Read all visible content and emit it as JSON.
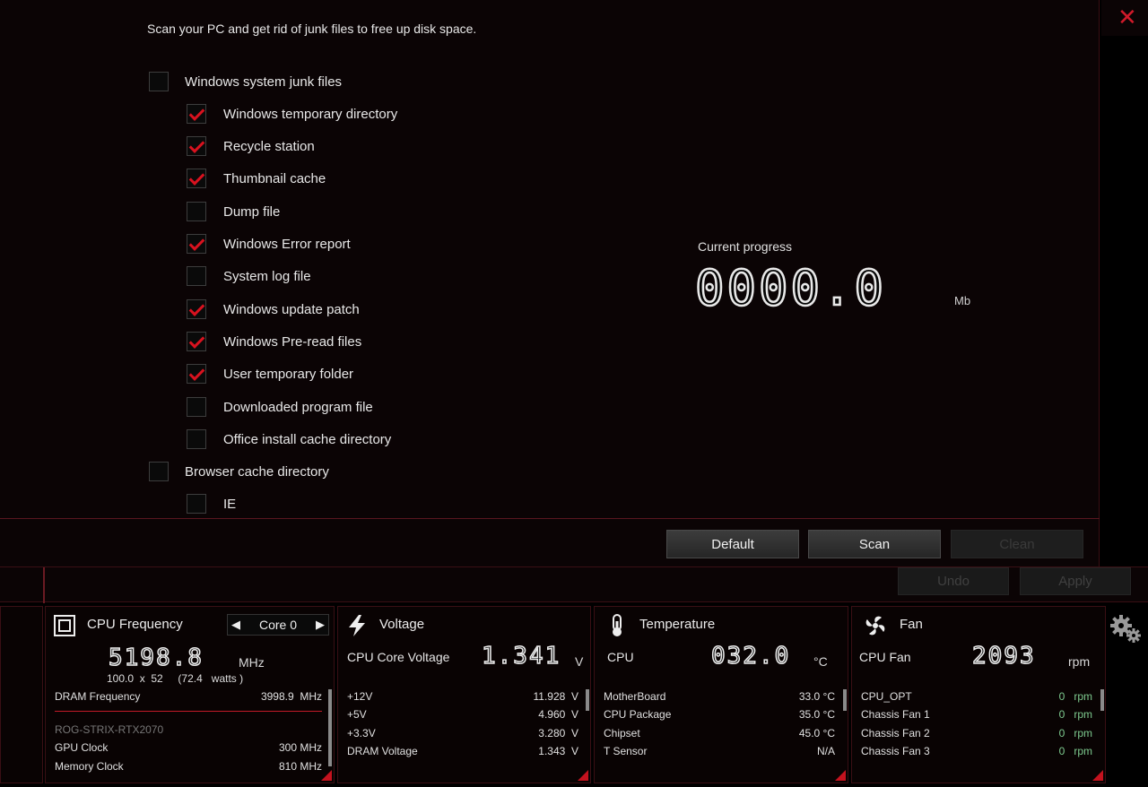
{
  "description": "Scan your PC and get rid of junk files to free up disk space.",
  "checklist": [
    {
      "label": "Windows system junk files",
      "checked": false,
      "level": 0
    },
    {
      "label": "Windows temporary directory",
      "checked": true,
      "level": 1
    },
    {
      "label": "Recycle station",
      "checked": true,
      "level": 1
    },
    {
      "label": "Thumbnail cache",
      "checked": true,
      "level": 1
    },
    {
      "label": "Dump file",
      "checked": false,
      "level": 1
    },
    {
      "label": "Windows Error report",
      "checked": true,
      "level": 1
    },
    {
      "label": "System log file",
      "checked": false,
      "level": 1
    },
    {
      "label": "Windows update patch",
      "checked": true,
      "level": 1
    },
    {
      "label": "Windows Pre-read files",
      "checked": true,
      "level": 1
    },
    {
      "label": "User temporary folder",
      "checked": true,
      "level": 1
    },
    {
      "label": "Downloaded program file",
      "checked": false,
      "level": 1
    },
    {
      "label": "Office install cache directory",
      "checked": false,
      "level": 1
    },
    {
      "label": "Browser cache directory",
      "checked": false,
      "level": 0
    },
    {
      "label": "IE",
      "checked": false,
      "level": 1
    }
  ],
  "progress": {
    "title": "Current progress",
    "value": "0000.0",
    "unit": "Mb"
  },
  "buttons": {
    "default": "Default",
    "scan": "Scan",
    "clean": "Clean",
    "undo": "Undo",
    "apply": "Apply"
  },
  "cpu": {
    "title": "CPU Frequency",
    "core_selector": "Core 0",
    "frequency": "5198.8",
    "freq_unit": "MHz",
    "bclk": "100.0",
    "x": "x",
    "multiplier": "52",
    "watts_open": "(",
    "watts": "72.4",
    "watts_unit": "watts",
    "watts_close": ")",
    "dram_label": "DRAM Frequency",
    "dram_value": "3998.9  MHz",
    "gpu_name": "ROG-STRIX-RTX2070",
    "gpu_clock_label": "GPU Clock",
    "gpu_clock_value": "300 MHz",
    "mem_clock_label": "Memory Clock",
    "mem_clock_value": "810 MHz"
  },
  "voltage": {
    "title": "Voltage",
    "main_label": "CPU Core Voltage",
    "main_value": "1.341",
    "main_unit": "V",
    "rows": [
      {
        "label": "+12V",
        "value": "11.928  V"
      },
      {
        "label": "+5V",
        "value": "4.960  V"
      },
      {
        "label": "+3.3V",
        "value": "3.280  V"
      },
      {
        "label": "DRAM Voltage",
        "value": "1.343  V"
      }
    ]
  },
  "temperature": {
    "title": "Temperature",
    "main_label": "CPU",
    "main_value": "032.0",
    "main_unit": "°C",
    "rows": [
      {
        "label": "MotherBoard",
        "value": "33.0 °C"
      },
      {
        "label": "CPU Package",
        "value": "35.0 °C"
      },
      {
        "label": "Chipset",
        "value": "45.0 °C"
      },
      {
        "label": "T Sensor",
        "value": "N/A"
      }
    ]
  },
  "fan": {
    "title": "Fan",
    "main_label": "CPU Fan",
    "main_value": "2093",
    "main_unit": "rpm",
    "rows": [
      {
        "label": "CPU_OPT",
        "value": "0",
        "unit": "rpm"
      },
      {
        "label": "Chassis Fan 1",
        "value": "0",
        "unit": "rpm"
      },
      {
        "label": "Chassis Fan 2",
        "value": "0",
        "unit": "rpm"
      },
      {
        "label": "Chassis Fan 3",
        "value": "0",
        "unit": "rpm"
      }
    ]
  },
  "colors": {
    "accent": "#d8121f",
    "background": "#0b0405",
    "border": "#3a0f14",
    "green": "#7ecb8f"
  },
  "icons": {
    "close": "close-icon",
    "cpu": "cpu-chip-icon",
    "voltage": "lightning-icon",
    "temperature": "thermometer-icon",
    "fan": "fan-icon",
    "settings": "gears-icon"
  }
}
